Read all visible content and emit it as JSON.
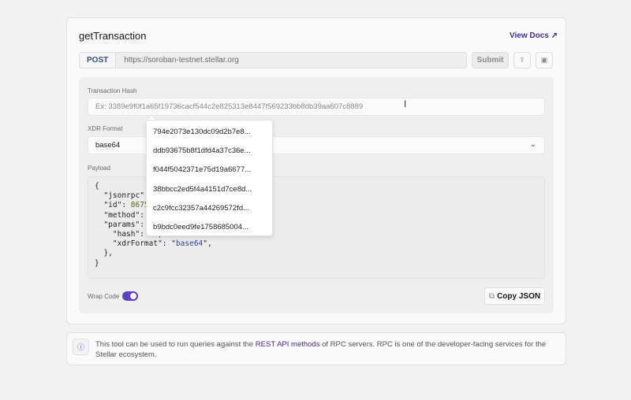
{
  "header": {
    "title": "getTransaction",
    "docs_label": "View Docs"
  },
  "request": {
    "method": "POST",
    "url": "https://soroban-testnet.stellar.org",
    "submit_label": "Submit"
  },
  "form": {
    "hash_label": "Transaction Hash",
    "hash_placeholder": "Ex: 3389e9f0f1a65f19736cacf544c2e825313e8447f569233bb8db39aa607c8889",
    "xdr_label": "XDR Format",
    "xdr_value": "base64",
    "payload_label": "Payload",
    "wrap_label": "Wrap Code",
    "wrap_on": true,
    "copy_label": "Copy JSON"
  },
  "payload_lines": {
    "l1": "{",
    "l2": "  \"jsonrpc\": ",
    "l3a": "  \"id\": ",
    "l3b": "86753",
    "l4": "  \"method\": \"",
    "l5": "  \"params\": {",
    "l6": "    \"hash\": \"\",",
    "l7a": "    \"xdrFormat\": \"",
    "l7b": "base64",
    "l7c": "\",",
    "l8": "  },",
    "l9": "}"
  },
  "suggestions": [
    "794e2073e130dc09d2b7e8...",
    "ddb93675b8f1dfd4a37c36e...",
    "f044f5042371e75d19a6677...",
    "38bbcc2ed5f4a4151d7ce8d...",
    "c2c9fcc32357a44269572fd...",
    "b9bdc0eed9fe1758685004..."
  ],
  "info": {
    "before": "This tool can be used to run queries against the ",
    "link": "REST API methods",
    "after": " of RPC servers. RPC is one of the developer-facing services for the Stellar ecosystem."
  },
  "colors": {
    "accent": "#5b3fc9",
    "link": "#3d2f9b"
  }
}
